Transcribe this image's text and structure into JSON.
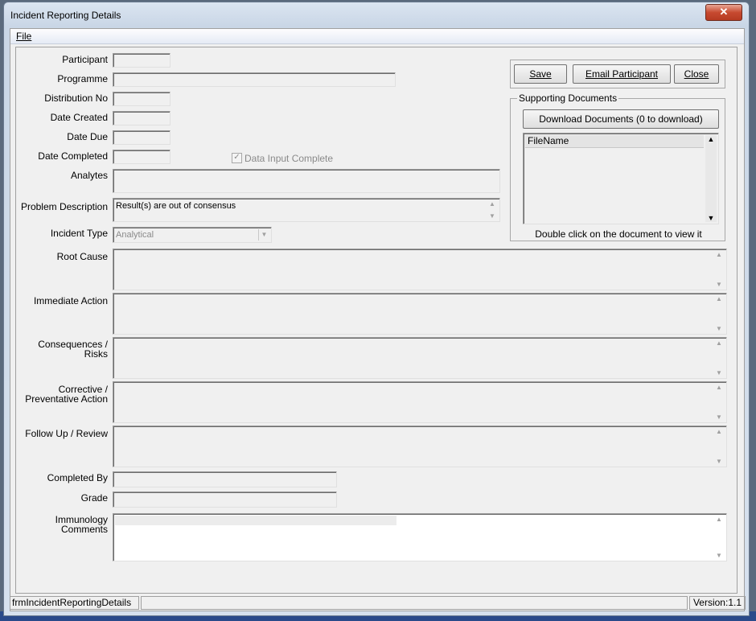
{
  "window": {
    "title": "Incident Reporting Details",
    "close_label": "✕"
  },
  "menu": {
    "file": "File"
  },
  "fields": {
    "participant": "Participant",
    "programme": "Programme",
    "distribution_no": "Distribution No",
    "date_created": "Date Created",
    "date_due": "Date Due",
    "date_completed": "Date Completed",
    "data_input_complete": "Data Input Complete",
    "analytes": "Analytes",
    "problem_description": "Problem Description",
    "problem_description_value": "Result(s) are out of consensus",
    "incident_type": "Incident Type",
    "incident_type_value": "Analytical",
    "root_cause": "Root Cause",
    "immediate_action": "Immediate Action",
    "consequences_1": "Consequences /",
    "consequences_2": "Risks",
    "corrective_1": "Corrective /",
    "corrective_2": "Preventative Action",
    "follow_up": "Follow Up / Review",
    "completed_by": "Completed By",
    "grade": "Grade",
    "immunology_1": "Immunology",
    "immunology_2": "Comments"
  },
  "buttons": {
    "save": "Save",
    "email": "Email Participant",
    "close": "Close",
    "download": "Download Documents (0 to download)"
  },
  "documents": {
    "group_label": "Supporting Documents",
    "column": "FileName",
    "hint": "Double click on the document to view it"
  },
  "status": {
    "form_name": "frmIncidentReportingDetails",
    "version": "Version:1.1"
  }
}
